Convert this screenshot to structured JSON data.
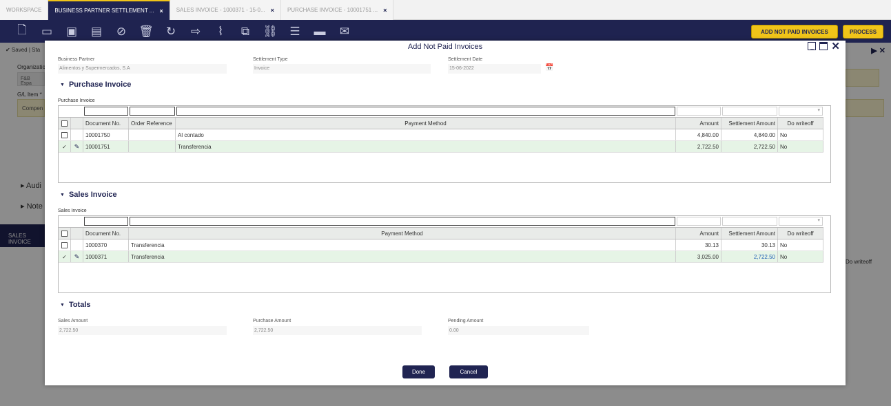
{
  "tabs": [
    {
      "label": "WORKSPACE",
      "close": ""
    },
    {
      "label": "BUSINESS PARTNER SETTLEMENT ...",
      "close": "×"
    },
    {
      "label": "SALES INVOICE - 1000371 - 15-0...",
      "close": "×"
    },
    {
      "label": "PURCHASE INVOICE - 10001751 ...",
      "close": "×"
    }
  ],
  "toolbar": {
    "icons": [
      "new-document-icon",
      "new-row-icon",
      "save-icon",
      "save-close-icon",
      "cancel-icon",
      "delete-icon",
      "refresh-icon",
      "export-icon",
      "attach-icon",
      "copy-icon",
      "link-icon",
      "audit-icon",
      "print-icon",
      "email-icon"
    ],
    "add_not_paid_label": "ADD NOT PAID INVOICES",
    "process_label": "PROCESS"
  },
  "background": {
    "status": "✔ Saved | Sta",
    "organization_label": "Organizatio",
    "organization_value": "F&B Espa",
    "gl_item_label": "G/L Item *",
    "gl_item_value": "Compen",
    "audit_label": "Audi",
    "notes_label": "Note",
    "sales_invoice_tab": "SALES INVOICE",
    "do_writeoff": "Do writeoff"
  },
  "modal": {
    "title": "Add Not Paid Invoices",
    "business_partner_label": "Business Partner",
    "business_partner_value": "Alimentos y Supermercados, S.A",
    "settlement_type_label": "Settlement Type",
    "settlement_type_value": "Invoice",
    "settlement_date_label": "Settlement Date",
    "settlement_date_value": "15-06-2022",
    "purchase": {
      "section_title": "Purchase Invoice",
      "grid_caption": "Purchase Invoice",
      "headers": [
        "Document No.",
        "Order Reference",
        "Payment Method",
        "Amount",
        "Settlement Amount",
        "Do writeoff"
      ],
      "rows": [
        {
          "doc": "10001750",
          "order_ref": "",
          "method": "Al contado",
          "amount": "4,840.00",
          "settlement": "4,840.00",
          "writeoff": "No",
          "selected": false
        },
        {
          "doc": "10001751",
          "order_ref": "",
          "method": "Transferencia",
          "amount": "2,722.50",
          "settlement": "2,722.50",
          "writeoff": "No",
          "selected": true
        }
      ]
    },
    "sales": {
      "section_title": "Sales Invoice",
      "grid_caption": "Sales Invoice",
      "headers": [
        "Document No.",
        "Payment Method",
        "Amount",
        "Settlement Amount",
        "Do writeoff"
      ],
      "rows": [
        {
          "doc": "1000370",
          "method": "Transferencia",
          "amount": "30.13",
          "settlement": "30.13",
          "writeoff": "No",
          "selected": false
        },
        {
          "doc": "1000371",
          "method": "Transferencia",
          "amount": "3,025.00",
          "settlement": "2,722.50",
          "writeoff": "No",
          "selected": true
        }
      ]
    },
    "totals": {
      "section_title": "Totals",
      "sales_amount_label": "Sales Amount",
      "sales_amount_value": "2,722.50",
      "purchase_amount_label": "Purchase Amount",
      "purchase_amount_value": "2,722.50",
      "pending_amount_label": "Pending Amount",
      "pending_amount_value": "0.00"
    },
    "done_label": "Done",
    "cancel_label": "Cancel"
  },
  "colors": {
    "navy": "#1f2350",
    "accent": "#f0c419",
    "selected_row": "#e6f4e6"
  }
}
